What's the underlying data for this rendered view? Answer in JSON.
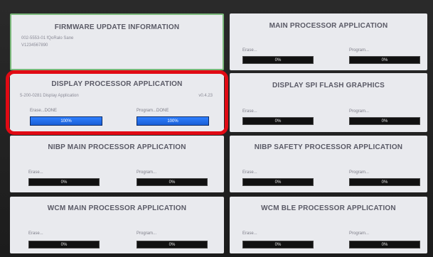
{
  "panels": {
    "firmware": {
      "title": "FIRMWARE UPDATE INFORMATION",
      "line1": "002-5553-01 fQoRalo Sane",
      "line2": "V1234567890"
    },
    "main_proc": {
      "title": "MAIN PROCESSOR APPLICATION",
      "erase_label": "Erase...",
      "program_label": "Program...",
      "erase_value": "0%",
      "program_value": "0%"
    },
    "display_proc": {
      "title": "DISPLAY PROCESSOR APPLICATION",
      "info": "5-200-0281 Display Application",
      "version": "v0.4.23",
      "erase_label": "Erase...DONE",
      "program_label": "Program...DONE",
      "erase_value": "100%",
      "program_value": "100%"
    },
    "spi_flash": {
      "title": "DISPLAY SPI FLASH GRAPHICS",
      "erase_label": "Erase...",
      "program_label": "Program...",
      "erase_value": "0%",
      "program_value": "0%"
    },
    "nibp_main": {
      "title": "NIBP MAIN PROCESSOR APPLICATION",
      "erase_label": "Erase...",
      "program_label": "Program...",
      "erase_value": "0%",
      "program_value": "0%"
    },
    "nibp_safety": {
      "title": "NIBP SAFETY PROCESSOR APPLICATION",
      "erase_label": "Erase...",
      "program_label": "Program...",
      "erase_value": "0%",
      "program_value": "0%"
    },
    "wcm_main": {
      "title": "WCM MAIN PROCESSOR APPLICATION",
      "erase_label": "Erase...",
      "program_label": "Program...",
      "erase_value": "0%",
      "program_value": "0%"
    },
    "wcm_ble": {
      "title": "WCM BLE PROCESSOR APPLICATION",
      "erase_label": "Erase...",
      "program_label": "Program...",
      "erase_value": "0%",
      "program_value": "0%"
    }
  },
  "progress": {
    "display_proc_erase": 1.0,
    "display_proc_program": 1.0,
    "others": 0.0
  },
  "colors": {
    "highlight": "#e10a14",
    "progress_fill": "#2f7fff",
    "panel_bg": "#e9eaee",
    "firmware_border": "#7ab87a"
  }
}
